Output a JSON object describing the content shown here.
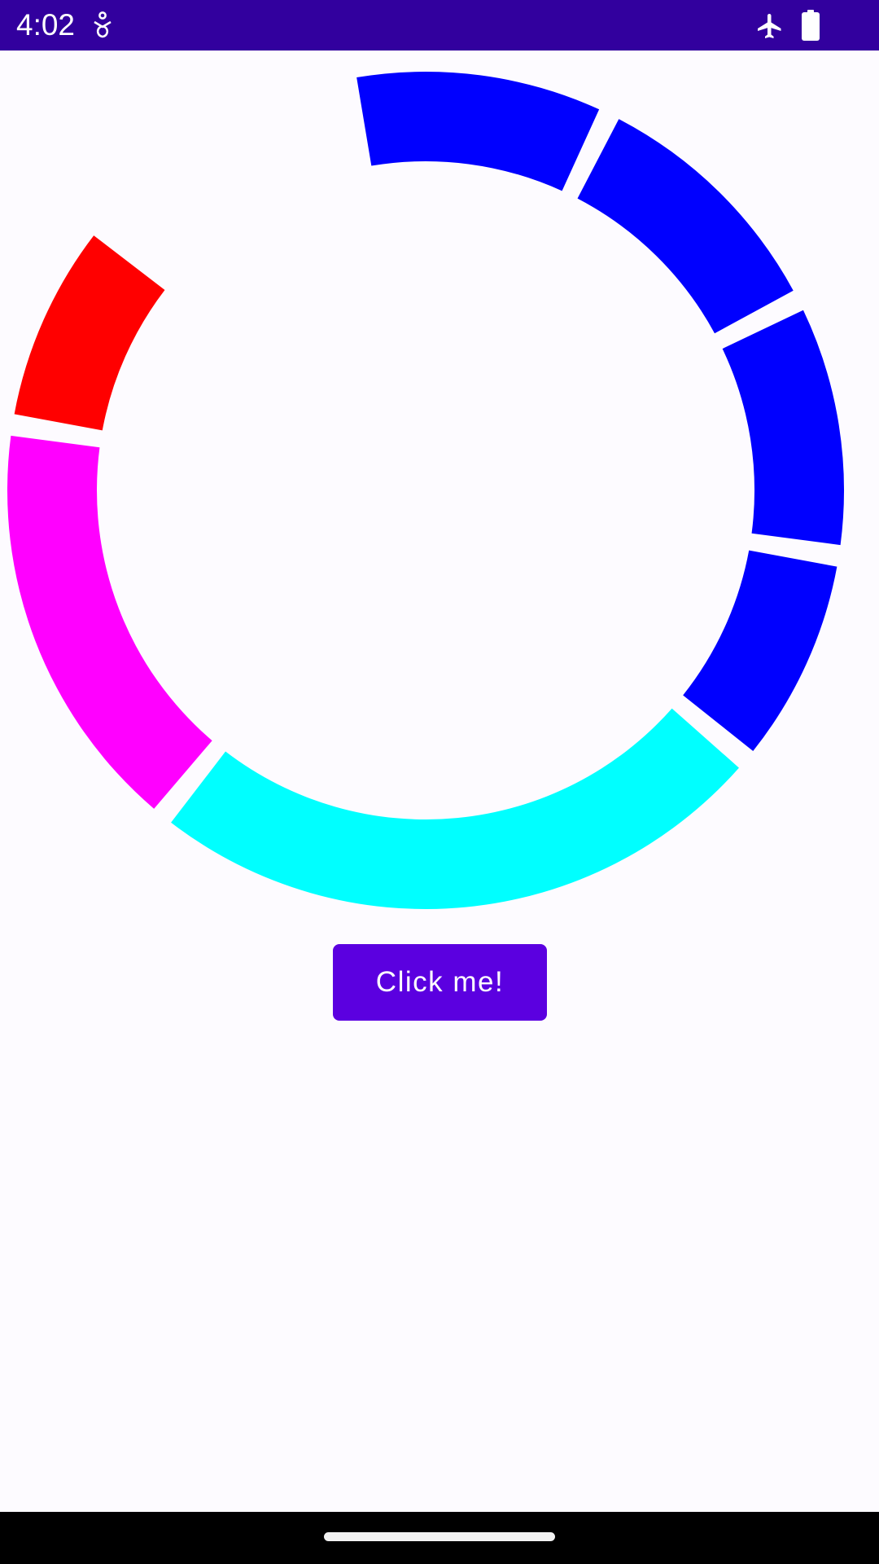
{
  "status_bar": {
    "time": "4:02",
    "background": "#32009e",
    "icons": [
      "accessibility-icon",
      "airplane-mode-icon",
      "battery-icon"
    ]
  },
  "donut": {
    "segments": [
      {
        "color": "#0000ff",
        "sweep_deg": 37
      },
      {
        "color": "#0000ff",
        "sweep_deg": 37
      },
      {
        "color": "#0000ff",
        "sweep_deg": 36
      },
      {
        "color": "#0000ff",
        "sweep_deg": 31
      },
      {
        "color": "#00ffff",
        "sweep_deg": 89
      },
      {
        "color": "#ff00ff",
        "sweep_deg": 60
      },
      {
        "color": "#ff0000",
        "sweep_deg": 30
      }
    ]
  },
  "button": {
    "label": "Click me!",
    "color": "#5b00e0"
  },
  "nav_bar": {
    "background": "#000000"
  }
}
